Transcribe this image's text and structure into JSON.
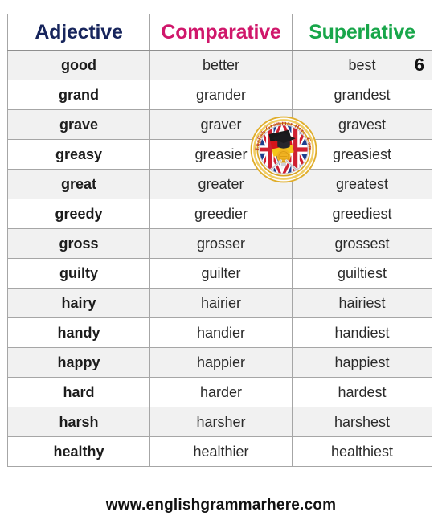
{
  "table": {
    "headers": {
      "adjective": "Adjective",
      "comparative": "Comparative",
      "superlative": "Superlative"
    },
    "header_colors": {
      "adjective": "#17255c",
      "comparative": "#d0176b",
      "superlative": "#18a64a"
    },
    "page_number": "6",
    "rows": [
      {
        "adjective": "good",
        "comparative": "better",
        "superlative": "best"
      },
      {
        "adjective": "grand",
        "comparative": "grander",
        "superlative": "grandest"
      },
      {
        "adjective": "grave",
        "comparative": "graver",
        "superlative": "gravest"
      },
      {
        "adjective": "greasy",
        "comparative": "greasier",
        "superlative": "greasiest"
      },
      {
        "adjective": "great",
        "comparative": "greater",
        "superlative": "greatest"
      },
      {
        "adjective": "greedy",
        "comparative": "greedier",
        "superlative": "greediest"
      },
      {
        "adjective": "gross",
        "comparative": "grosser",
        "superlative": "grossest"
      },
      {
        "adjective": "guilty",
        "comparative": "guilter",
        "superlative": "guiltiest"
      },
      {
        "adjective": "hairy",
        "comparative": "hairier",
        "superlative": "hairiest"
      },
      {
        "adjective": "handy",
        "comparative": "handier",
        "superlative": "handiest"
      },
      {
        "adjective": "happy",
        "comparative": "happier",
        "superlative": "happiest"
      },
      {
        "adjective": "hard",
        "comparative": "harder",
        "superlative": "hardest"
      },
      {
        "adjective": "harsh",
        "comparative": "harsher",
        "superlative": "harshest"
      },
      {
        "adjective": "healthy",
        "comparative": "healthier",
        "superlative": "healthiest"
      }
    ]
  },
  "watermark": {
    "name": "english-grammar-here-logo",
    "text": "English Grammar Here .Com",
    "ring_color": "#e8b32a",
    "text_color": "#c0392b"
  },
  "footer": {
    "url": "www.englishgrammarhere.com"
  }
}
